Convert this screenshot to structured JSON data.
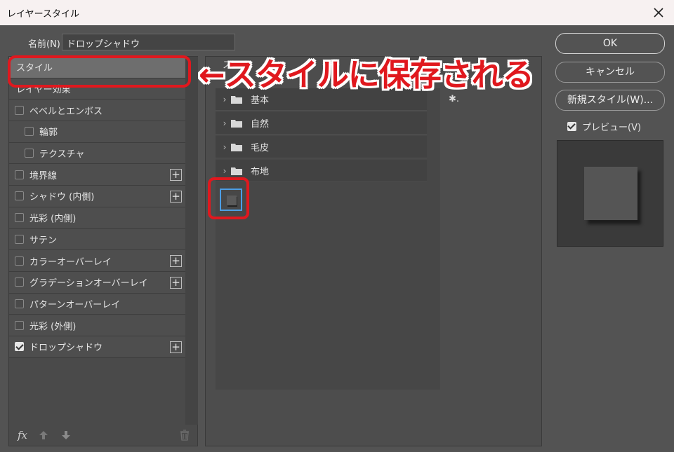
{
  "window": {
    "title": "レイヤースタイル"
  },
  "name_field": {
    "label": "名前(N) :",
    "value": "ドロップシャドウ"
  },
  "left_list": {
    "items": [
      {
        "label": "スタイル",
        "checkbox": false,
        "checked": false,
        "plus": false,
        "selected": true,
        "indent": false
      },
      {
        "label": "レイヤー効果",
        "checkbox": false,
        "checked": false,
        "plus": false,
        "selected": false,
        "indent": false
      },
      {
        "label": "ベベルとエンボス",
        "checkbox": true,
        "checked": false,
        "plus": false,
        "selected": false,
        "indent": false
      },
      {
        "label": "輪郭",
        "checkbox": true,
        "checked": false,
        "plus": false,
        "selected": false,
        "indent": true
      },
      {
        "label": "テクスチャ",
        "checkbox": true,
        "checked": false,
        "plus": false,
        "selected": false,
        "indent": true
      },
      {
        "label": "境界線",
        "checkbox": true,
        "checked": false,
        "plus": true,
        "selected": false,
        "indent": false
      },
      {
        "label": "シャドウ (内側)",
        "checkbox": true,
        "checked": false,
        "plus": true,
        "selected": false,
        "indent": false
      },
      {
        "label": "光彩 (内側)",
        "checkbox": true,
        "checked": false,
        "plus": false,
        "selected": false,
        "indent": false
      },
      {
        "label": "サテン",
        "checkbox": true,
        "checked": false,
        "plus": false,
        "selected": false,
        "indent": false
      },
      {
        "label": "カラーオーバーレイ",
        "checkbox": true,
        "checked": false,
        "plus": true,
        "selected": false,
        "indent": false
      },
      {
        "label": "グラデーションオーバーレイ",
        "checkbox": true,
        "checked": false,
        "plus": true,
        "selected": false,
        "indent": false
      },
      {
        "label": "パターンオーバーレイ",
        "checkbox": true,
        "checked": false,
        "plus": false,
        "selected": false,
        "indent": false
      },
      {
        "label": "光彩 (外側)",
        "checkbox": true,
        "checked": false,
        "plus": false,
        "selected": false,
        "indent": false
      },
      {
        "label": "ドロップシャドウ",
        "checkbox": true,
        "checked": true,
        "plus": true,
        "selected": false,
        "indent": false
      }
    ],
    "bottom": {
      "fx_label": "fx"
    }
  },
  "styles_panel": {
    "header_partial": "ス",
    "folders": [
      "基本",
      "自然",
      "毛皮",
      "布地"
    ],
    "gear_label": "✱."
  },
  "buttons": {
    "ok": "OK",
    "cancel": "キャンセル",
    "new_style": "新規スタイル(W)..."
  },
  "preview": {
    "label": "プレビュー(V)",
    "checked": true
  },
  "annotation": {
    "text": "←スタイルに保存される",
    "color": "#e0181e"
  }
}
